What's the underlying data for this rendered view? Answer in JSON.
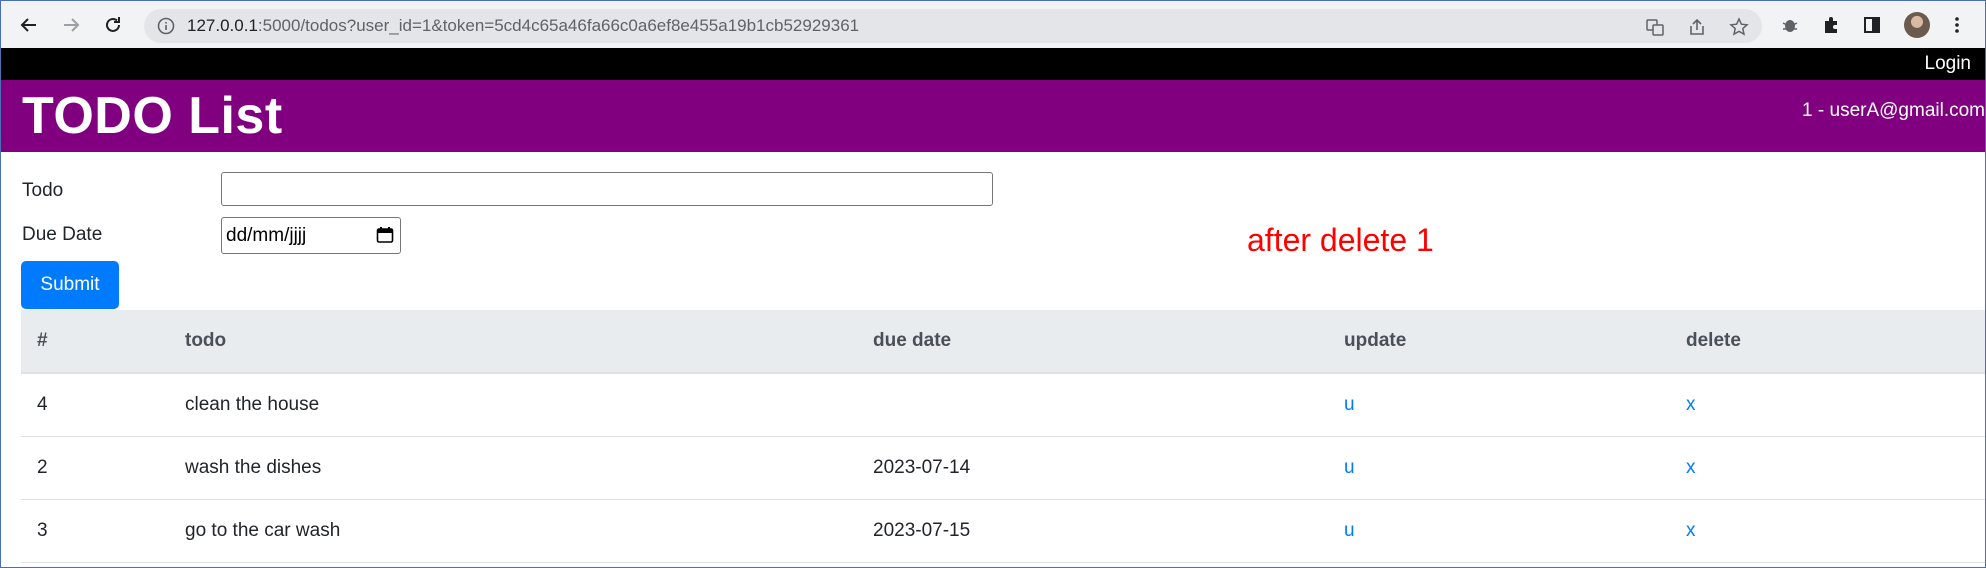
{
  "browser": {
    "url_host": "127.0.0.1",
    "url_rest": ":5000/todos?user_id=1&token=5cd4c65a46fa66c0a6ef8e455a19b1cb52929361"
  },
  "nav": {
    "login_label": "Login"
  },
  "header": {
    "title": "TODO List",
    "user": "1 - userA@gmail.com"
  },
  "form": {
    "todo_label": "Todo",
    "todo_value": "",
    "due_label": "Due Date",
    "due_placeholder": "dd/mm/jjjj",
    "submit_label": "Submit"
  },
  "annotation": "after delete 1",
  "table": {
    "headers": [
      "#",
      "todo",
      "due date",
      "update",
      "delete"
    ],
    "rows": [
      {
        "id": "4",
        "todo": "clean the house",
        "due": "",
        "update": "u",
        "delete": "x"
      },
      {
        "id": "2",
        "todo": "wash the dishes",
        "due": "2023-07-14",
        "update": "u",
        "delete": "x"
      },
      {
        "id": "3",
        "todo": "go to the car wash",
        "due": "2023-07-15",
        "update": "u",
        "delete": "x"
      }
    ]
  },
  "colors": {
    "header_bg": "#800080",
    "topbar_bg": "#000000",
    "primary": "#007bff",
    "annotation": "#ff0000"
  }
}
